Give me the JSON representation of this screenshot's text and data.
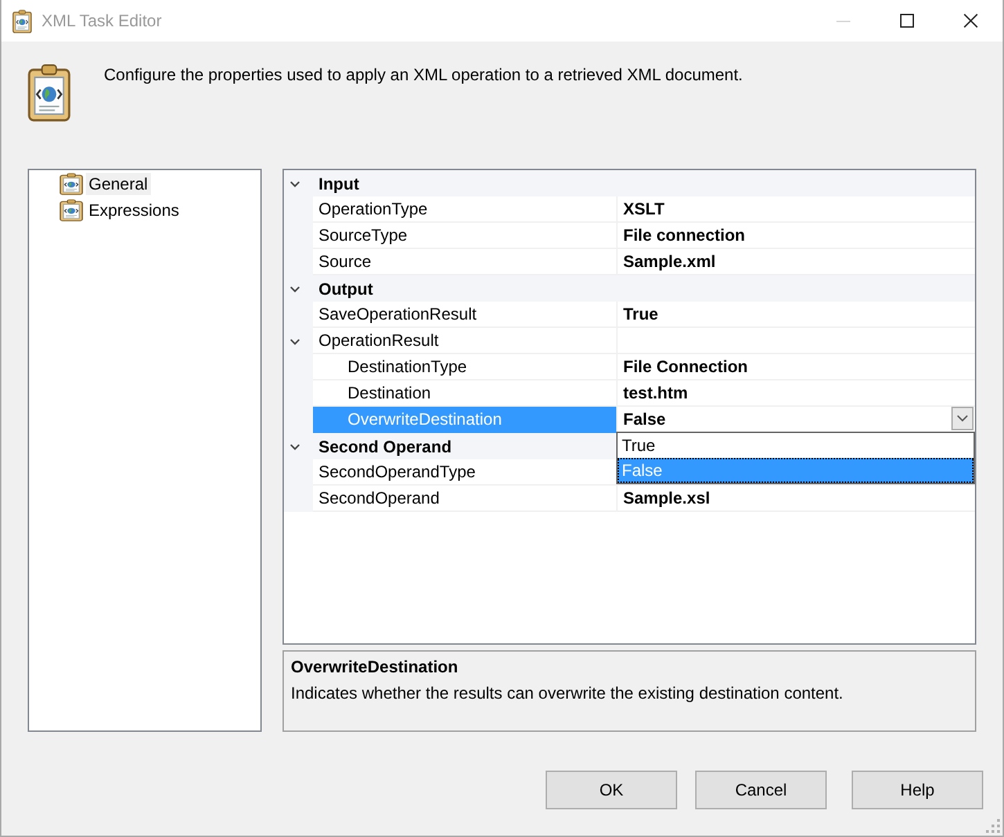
{
  "window": {
    "title": "XML Task Editor",
    "minimize_disabled": true
  },
  "header": {
    "description": "Configure the properties used to apply an XML operation to a retrieved XML document."
  },
  "sidebar": {
    "items": [
      {
        "label": "General",
        "selected": true
      },
      {
        "label": "Expressions",
        "selected": false
      }
    ]
  },
  "property_grid": {
    "categories": [
      {
        "label": "Input",
        "expanded": true,
        "children": [
          {
            "name": "OperationType",
            "value": "XSLT",
            "selected": false
          },
          {
            "name": "SourceType",
            "value": "File connection",
            "selected": false
          },
          {
            "name": "Source",
            "value": "Sample.xml",
            "selected": false
          }
        ]
      },
      {
        "label": "Output",
        "expanded": true,
        "children": [
          {
            "name": "SaveOperationResult",
            "value": "True",
            "selected": false
          },
          {
            "name": "OperationResult",
            "expanded": true,
            "selected": false,
            "children": [
              {
                "name": "DestinationType",
                "value": "File Connection",
                "selected": false
              },
              {
                "name": "Destination",
                "value": "test.htm",
                "selected": false
              },
              {
                "name": "OverwriteDestination",
                "value": "False",
                "selected": true,
                "open": true,
                "options": [
                  {
                    "label": "True",
                    "selected": false
                  },
                  {
                    "label": "False",
                    "selected": true
                  }
                ]
              }
            ]
          }
        ]
      },
      {
        "label": "Second Operand",
        "expanded": true,
        "children": [
          {
            "name": "SecondOperandType",
            "selected": false
          },
          {
            "name": "SecondOperand",
            "value": "Sample.xsl",
            "selected": false
          }
        ]
      }
    ]
  },
  "description": {
    "title": "OverwriteDestination",
    "text": "Indicates whether the results can overwrite the existing destination content."
  },
  "buttons": [
    "OK",
    "Cancel",
    "Help"
  ]
}
